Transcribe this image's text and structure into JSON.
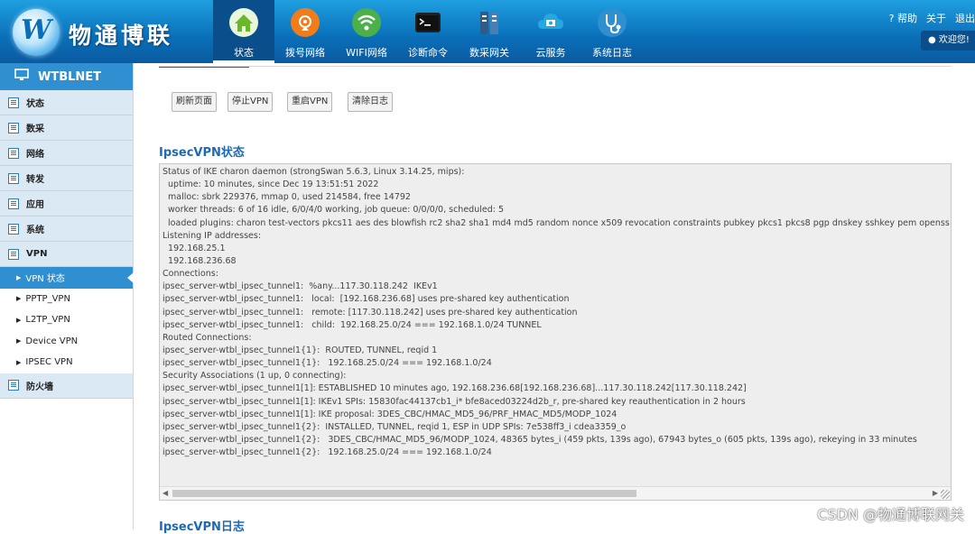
{
  "header": {
    "logo_mark": "W",
    "brand": "物通博联",
    "nav": [
      {
        "label": "状态",
        "icon": "home-icon",
        "active": true,
        "color": "#6ab82a"
      },
      {
        "label": "拨号网络",
        "icon": "dialup-icon",
        "active": false,
        "color": "#f07c1c"
      },
      {
        "label": "WIFI网络",
        "icon": "wifi-icon",
        "active": false,
        "color": "#4cb04a"
      },
      {
        "label": "诊断命令",
        "icon": "terminal-icon",
        "active": false,
        "color": "#222222"
      },
      {
        "label": "数采网关",
        "icon": "gateway-icon",
        "active": false,
        "color": "#3d6b9c"
      },
      {
        "label": "云服务",
        "icon": "cloud-icon",
        "active": false,
        "color": "#26a7de"
      },
      {
        "label": "系统日志",
        "icon": "stethoscope-icon",
        "active": false,
        "color": "#2f8fd0"
      }
    ],
    "help": "帮助",
    "about": "关于",
    "logout": "退出",
    "welcome": "欢迎您!"
  },
  "sidebar": {
    "title": "WTBLNET",
    "groups_top": [
      "状态",
      "数采",
      "网络",
      "转发",
      "应用",
      "系统",
      "VPN"
    ],
    "vpn_items": [
      "VPN 状态",
      "PPTP_VPN",
      "L2TP_VPN",
      "Device VPN",
      "IPSEC VPN"
    ],
    "active_item": "VPN 状态",
    "groups_bottom": [
      "防火墙"
    ]
  },
  "toolbar": {
    "refresh": "刷新页面",
    "stop_vpn": "停止VPN",
    "restart_vpn": "重启VPN",
    "clear_log": "清除日志"
  },
  "status": {
    "title": "IpsecVPN状态",
    "lines": [
      "Status of IKE charon daemon (strongSwan 5.6.3, Linux 3.14.25, mips):",
      "  uptime: 10 minutes, since Dec 19 13:51:51 2022",
      "  malloc: sbrk 229376, mmap 0, used 214584, free 14792",
      "  worker threads: 6 of 16 idle, 6/0/4/0 working, job queue: 0/0/0/0, scheduled: 5",
      "  loaded plugins: charon test-vectors pkcs11 aes des blowfish rc2 sha2 sha1 md4 md5 random nonce x509 revocation constraints pubkey pkcs1 pkcs8 pgp dnskey sshkey pem openssl gcrypt af-",
      "Listening IP addresses:",
      "  192.168.25.1",
      "  192.168.236.68",
      "Connections:",
      "ipsec_server-wtbl_ipsec_tunnel1:  %any...117.30.118.242  IKEv1",
      "ipsec_server-wtbl_ipsec_tunnel1:   local:  [192.168.236.68] uses pre-shared key authentication",
      "ipsec_server-wtbl_ipsec_tunnel1:   remote: [117.30.118.242] uses pre-shared key authentication",
      "ipsec_server-wtbl_ipsec_tunnel1:   child:  192.168.25.0/24 === 192.168.1.0/24 TUNNEL",
      "Routed Connections:",
      "ipsec_server-wtbl_ipsec_tunnel1{1}:  ROUTED, TUNNEL, reqid 1",
      "ipsec_server-wtbl_ipsec_tunnel1{1}:   192.168.25.0/24 === 192.168.1.0/24",
      "Security Associations (1 up, 0 connecting):",
      "ipsec_server-wtbl_ipsec_tunnel1[1]: ESTABLISHED 10 minutes ago, 192.168.236.68[192.168.236.68]...117.30.118.242[117.30.118.242]",
      "ipsec_server-wtbl_ipsec_tunnel1[1]: IKEv1 SPIs: 15830fac44137cb1_i* bfe8aced03224d2b_r, pre-shared key reauthentication in 2 hours",
      "ipsec_server-wtbl_ipsec_tunnel1[1]: IKE proposal: 3DES_CBC/HMAC_MD5_96/PRF_HMAC_MD5/MODP_1024",
      "ipsec_server-wtbl_ipsec_tunnel1{2}:  INSTALLED, TUNNEL, reqid 1, ESP in UDP SPIs: 7e538ff3_i cdea3359_o",
      "ipsec_server-wtbl_ipsec_tunnel1{2}:   3DES_CBC/HMAC_MD5_96/MODP_1024, 48365 bytes_i (459 pkts, 139s ago), 67943 bytes_o (605 pkts, 139s ago), rekeying in 33 minutes",
      "ipsec_server-wtbl_ipsec_tunnel1{2}:   192.168.25.0/24 === 192.168.1.0/24"
    ]
  },
  "log": {
    "title": "IpsecVPN日志"
  },
  "watermark": "CSDN @物通博联网关"
}
